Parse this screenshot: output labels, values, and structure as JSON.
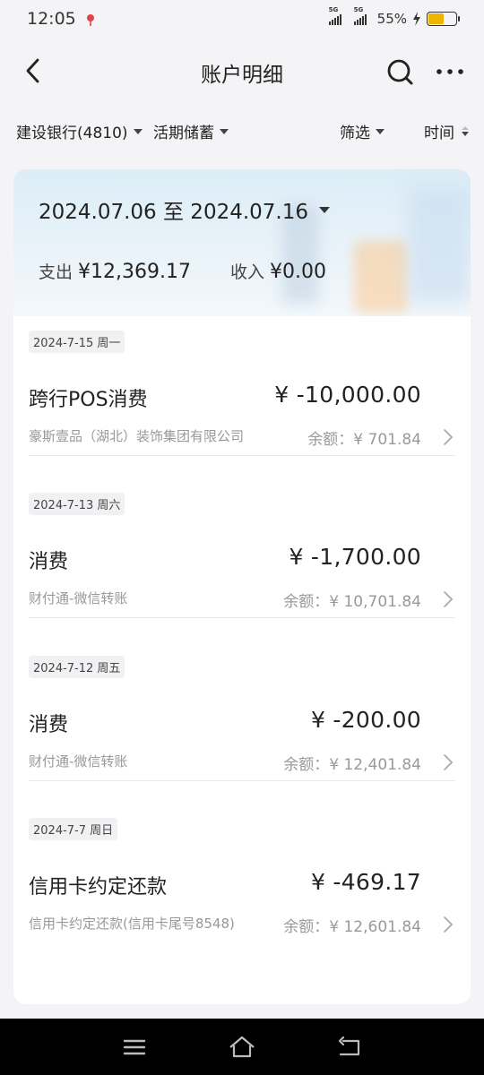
{
  "status_bar": {
    "time": "12:05",
    "network1": "5G",
    "network2": "5G",
    "battery": "55%"
  },
  "header": {
    "title": "账户明细"
  },
  "filters": {
    "account": "建设银行(4810)",
    "type": "活期储蓄",
    "filter": "筛选",
    "sort": "时间"
  },
  "summary": {
    "date_range": "2024.07.06 至 2024.07.16",
    "expense_label": "支出",
    "expense_amount": "¥12,369.17",
    "income_label": "收入",
    "income_amount": "¥0.00"
  },
  "transactions": [
    {
      "date": "2024-7-15 周一",
      "name": "跨行POS消费",
      "amount": "¥ -10,000.00",
      "party": "豪斯壹品（湖北）装饰集团有限公司",
      "balance": "余额：¥ 701.84"
    },
    {
      "date": "2024-7-13 周六",
      "name": "消费",
      "amount": "¥ -1,700.00",
      "party": "财付通-微信转账",
      "balance": "余额：¥ 10,701.84"
    },
    {
      "date": "2024-7-12 周五",
      "name": "消费",
      "amount": "¥ -200.00",
      "party": "财付通-微信转账",
      "balance": "余额：¥ 12,401.84"
    },
    {
      "date": "2024-7-7 周日",
      "name": "信用卡约定还款",
      "amount": "¥ -469.17",
      "party": "信用卡约定还款(信用卡尾号8548)",
      "balance": "余额：¥ 12,601.84"
    }
  ],
  "colors": {
    "background": "#f4f4f6",
    "card": "#ffffff",
    "battery_fill": "#f0b400",
    "nav_bar": "#000000"
  }
}
